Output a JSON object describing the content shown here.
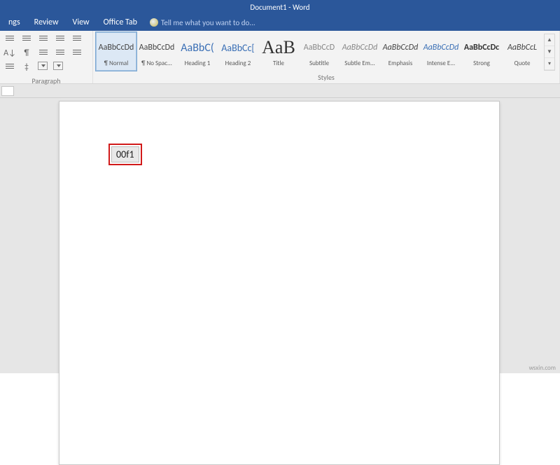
{
  "title": "Document1 - Word",
  "tabs": {
    "t0": "ngs",
    "t1": "Review",
    "t2": "View",
    "t3": "Office Tab"
  },
  "tellme": "Tell me what you want to do...",
  "groups": {
    "paragraph": "Paragraph",
    "styles": "Styles"
  },
  "styles": [
    {
      "name": "¶ Normal",
      "prev": "AaBbCcDd",
      "css": "font:12px Calibri;color:#444"
    },
    {
      "name": "¶ No Spac...",
      "prev": "AaBbCcDd",
      "css": "font:12px Calibri;color:#444"
    },
    {
      "name": "Heading 1",
      "prev": "AaBbC(",
      "css": "font:16px Calibri;color:#3a6fb5"
    },
    {
      "name": "Heading 2",
      "prev": "AaBbCc[",
      "css": "font:14px Calibri;color:#3a6fb5"
    },
    {
      "name": "Title",
      "prev": "AaB",
      "css": "font:26px 'Calibri Light';color:#333"
    },
    {
      "name": "Subtitle",
      "prev": "AaBbCcD",
      "css": "font:12px Calibri;color:#888"
    },
    {
      "name": "Subtle Em...",
      "prev": "AaBbCcDd",
      "css": "font:italic 12px Calibri;color:#888"
    },
    {
      "name": "Emphasis",
      "prev": "AaBbCcDd",
      "css": "font:italic 12px Calibri;color:#444"
    },
    {
      "name": "Intense E...",
      "prev": "AaBbCcDd",
      "css": "font:italic 12px Calibri;color:#3a6fb5"
    },
    {
      "name": "Strong",
      "prev": "AaBbCcDc",
      "css": "font:bold 12px Calibri;color:#333"
    },
    {
      "name": "Quote",
      "prev": "AaBbCcL",
      "css": "font:italic 12px Calibri;color:#444"
    }
  ],
  "doc_text": "00f1",
  "watermark": "wsxin.com"
}
